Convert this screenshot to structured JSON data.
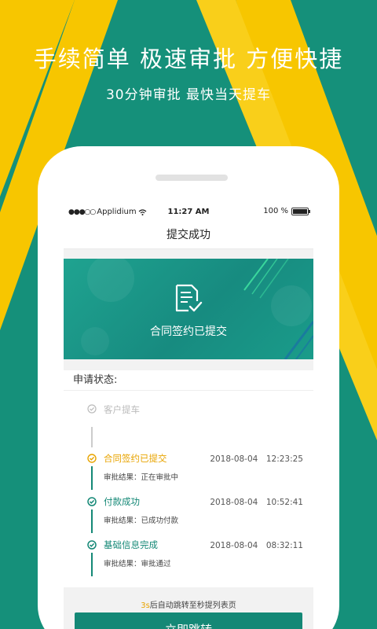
{
  "promo": {
    "headline": "手续简单 极速审批 方便快捷",
    "subline": "30分钟审批 最快当天提车"
  },
  "statusbar": {
    "carrier": "Applidium",
    "time": "11:27 AM",
    "battery": "100 %",
    "battery_level": 1.0
  },
  "nav": {
    "title": "提交成功"
  },
  "banner": {
    "text": "合同签约已提交",
    "icon": "document-check-icon"
  },
  "status_section": {
    "label": "申请状态:"
  },
  "timeline": [
    {
      "title": "客户提车",
      "time": "",
      "result": "",
      "state": "pending"
    },
    {
      "title": "合同签约已提交",
      "time": "2018-08-04　12:23:25",
      "result": "审批结果：正在审批中",
      "state": "in-progress"
    },
    {
      "title": "付款成功",
      "time": "2018-08-04　10:52:41",
      "result": "审批结果：已成功付款",
      "state": "done"
    },
    {
      "title": "基础信息完成",
      "time": "2018-08-04　08:32:11",
      "result": "审批结果：审批通过",
      "state": "done"
    }
  ],
  "footer": {
    "countdown": "3s",
    "redirect_text": "后自动跳转至秒提列表页",
    "button_label": "立即跳转"
  },
  "colors": {
    "brand_green": "#148876",
    "accent_yellow": "#f7c600",
    "pending_gray": "#bbbbbb"
  }
}
